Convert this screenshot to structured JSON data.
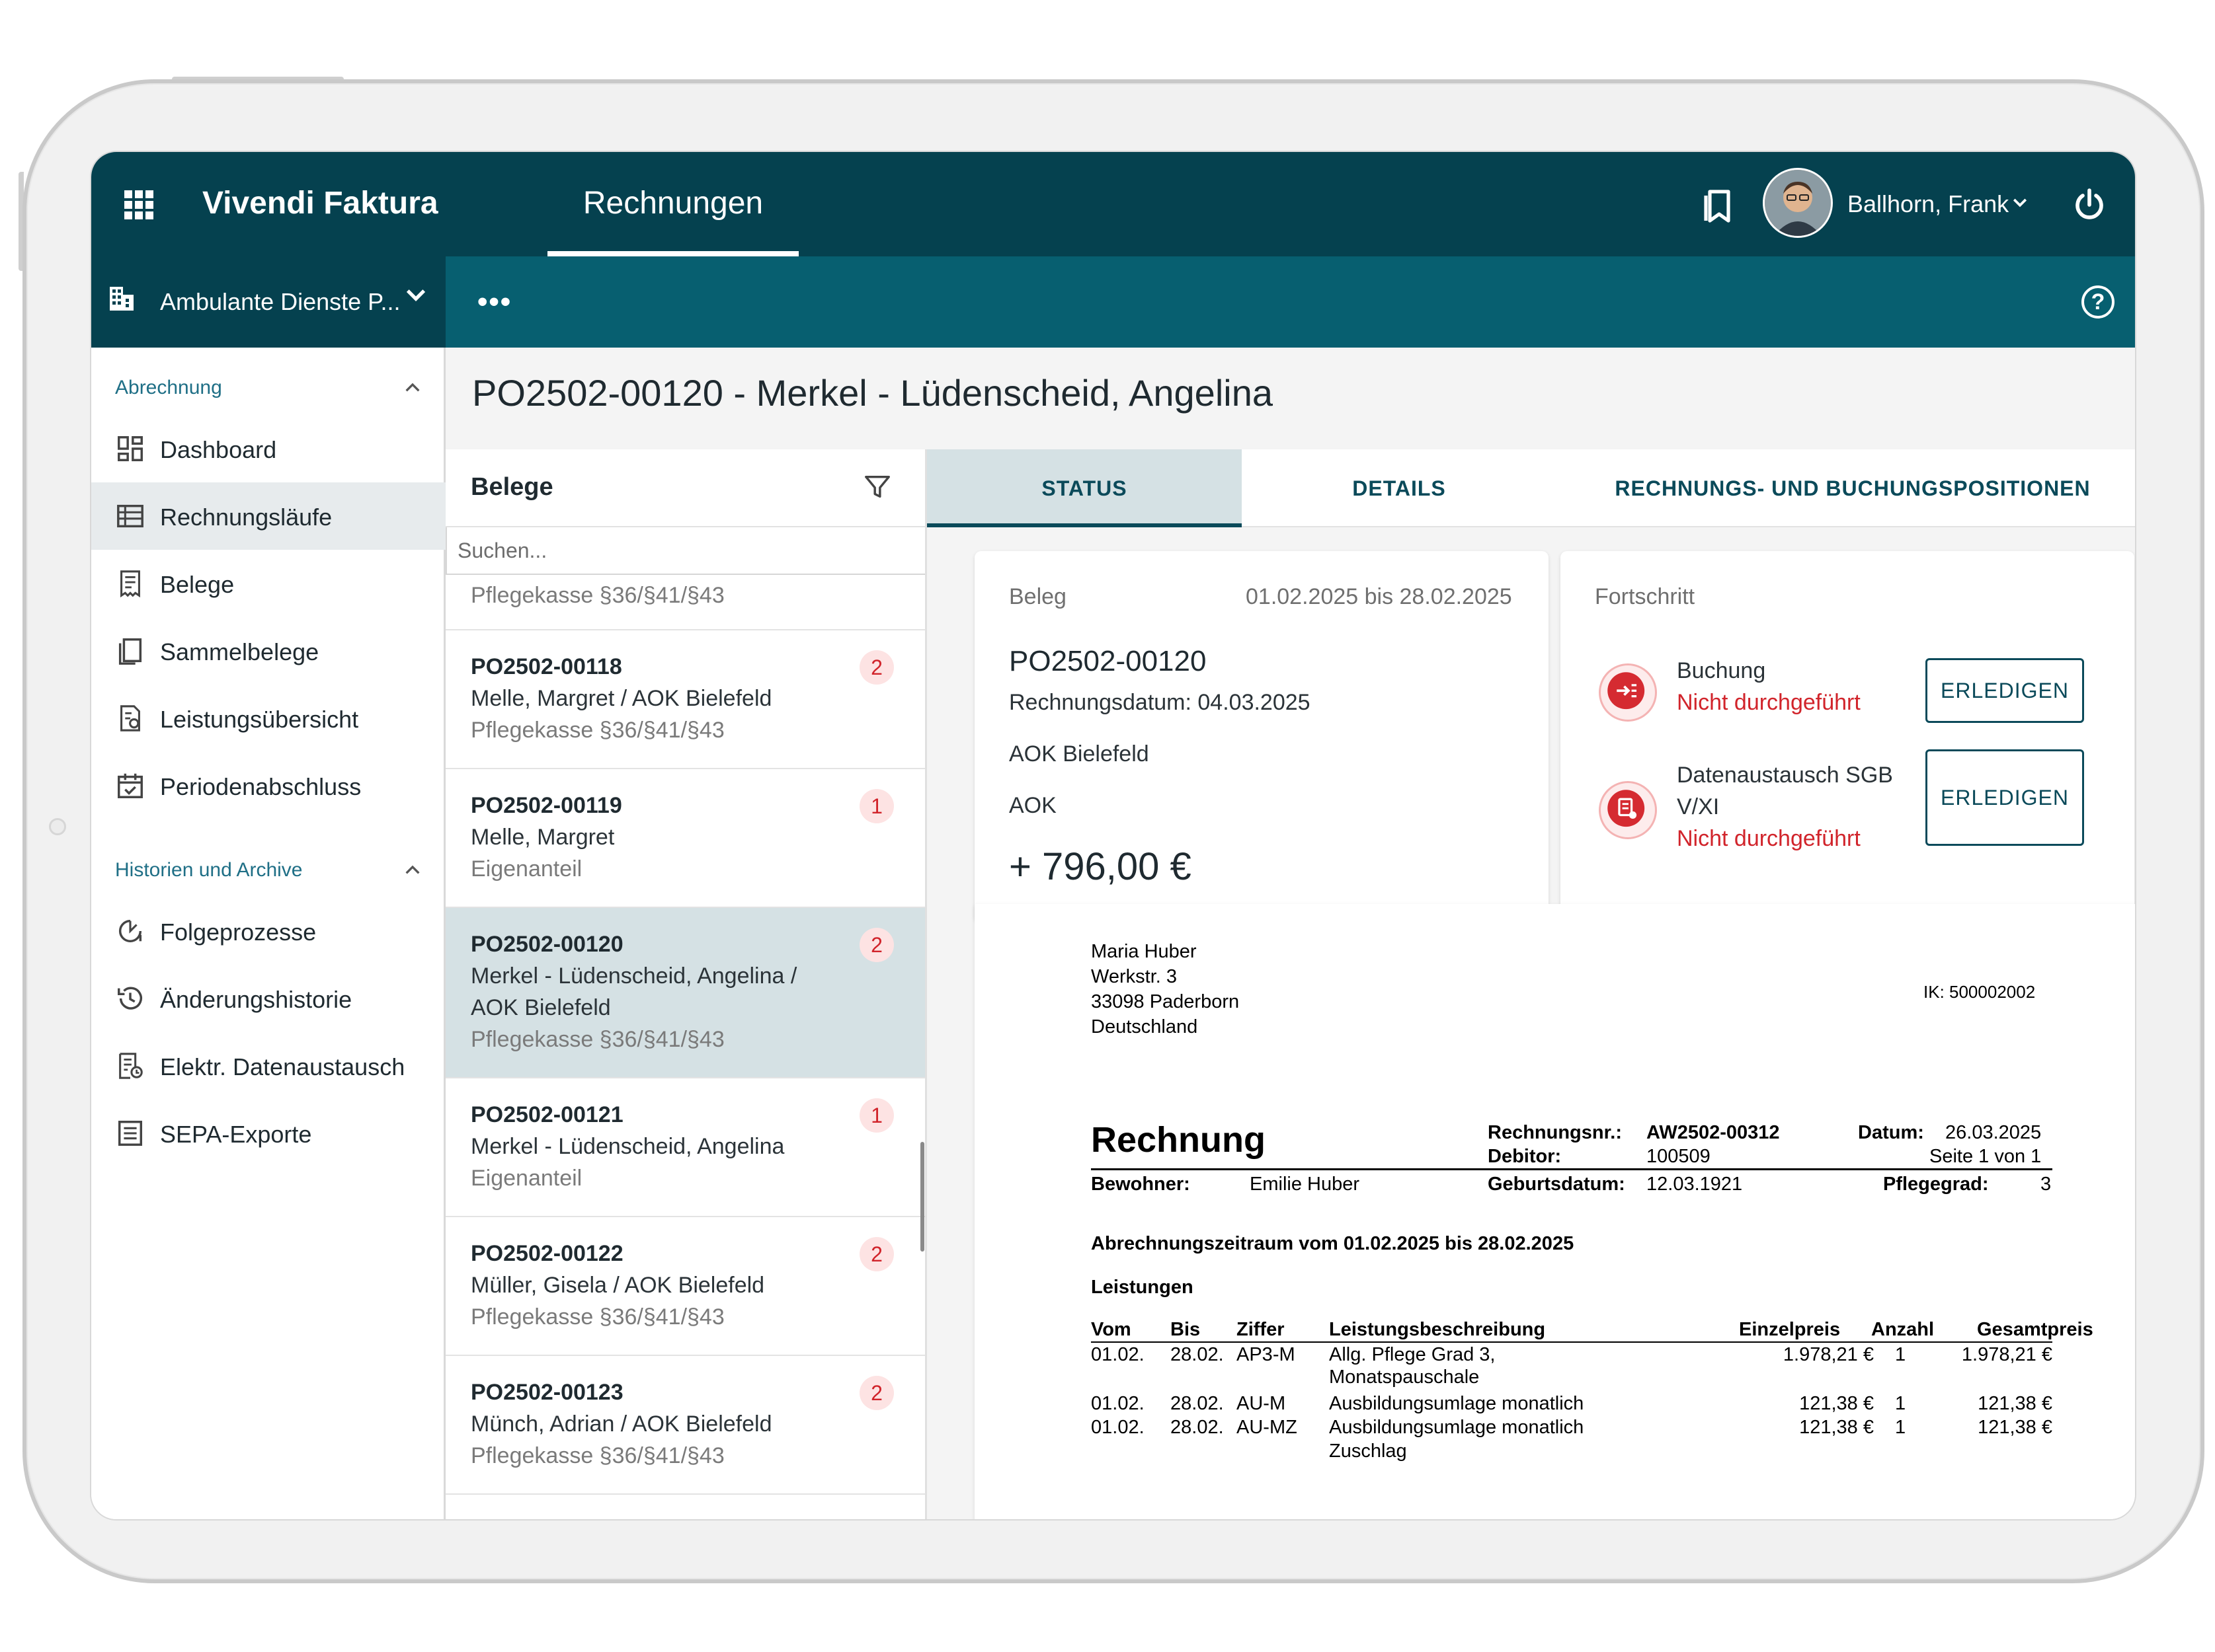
{
  "app": {
    "title": "Vivendi Faktura",
    "nav_tab": "Rechnungen",
    "user": {
      "name": "Ballhorn, Frank"
    }
  },
  "org": {
    "label": "Ambulante Dienste P..."
  },
  "sidebar": {
    "sections": [
      {
        "title": "Abrechnung",
        "items": [
          {
            "label": "Dashboard",
            "icon": "dashboard-icon"
          },
          {
            "label": "Rechnungsläufe",
            "icon": "table-icon",
            "active": true
          },
          {
            "label": "Belege",
            "icon": "receipt-icon"
          },
          {
            "label": "Sammelbelege",
            "icon": "copy-icon"
          },
          {
            "label": "Leistungsübersicht",
            "icon": "document-settings-icon"
          },
          {
            "label": "Periodenabschluss",
            "icon": "calendar-check-icon"
          }
        ]
      },
      {
        "title": "Historien und Archive",
        "items": [
          {
            "label": "Folgeprozesse",
            "icon": "process-icon"
          },
          {
            "label": "Änderungshistorie",
            "icon": "history-icon"
          },
          {
            "label": "Elektr. Datenaustausch",
            "icon": "data-exchange-icon"
          },
          {
            "label": "SEPA-Exporte",
            "icon": "list-icon"
          }
        ]
      }
    ]
  },
  "page": {
    "title": "PO2502-00120 - Merkel - Lüdenscheid, Angelina"
  },
  "belege": {
    "title": "Belege",
    "search_placeholder": "Suchen...",
    "partial_item_type": "Pflegekasse §36/§41/§43",
    "items": [
      {
        "id": "PO2502-00118",
        "name": "Melle, Margret / AOK Bielefeld",
        "type": "Pflegekasse §36/§41/§43",
        "badge": "2"
      },
      {
        "id": "PO2502-00119",
        "name": "Melle, Margret",
        "type": "Eigenanteil",
        "badge": "1"
      },
      {
        "id": "PO2502-00120",
        "name": "Merkel - Lüdenscheid, Angelina /",
        "name2": "AOK Bielefeld",
        "type": "Pflegekasse §36/§41/§43",
        "badge": "2",
        "active": true
      },
      {
        "id": "PO2502-00121",
        "name": "Merkel - Lüdenscheid, Angelina",
        "type": "Eigenanteil",
        "badge": "1"
      },
      {
        "id": "PO2502-00122",
        "name": "Müller, Gisela / AOK Bielefeld",
        "type": "Pflegekasse §36/§41/§43",
        "badge": "2"
      },
      {
        "id": "PO2502-00123",
        "name": "Münch, Adrian / AOK Bielefeld",
        "type": "Pflegekasse §36/§41/§43",
        "badge": "2"
      }
    ]
  },
  "tabs": [
    "STATUS",
    "DETAILS",
    "RECHNUNGS- UND BUCHUNGSPOSITIONEN"
  ],
  "beleg_card": {
    "label": "Beleg",
    "period": "01.02.2025 bis 28.02.2025",
    "id": "PO2502-00120",
    "date": "Rechnungsdatum: 04.03.2025",
    "kasse": "AOK Bielefeld",
    "kasse_short": "AOK",
    "amount": "+ 796,00 €"
  },
  "progress_card": {
    "title": "Fortschritt",
    "steps": [
      {
        "title": "Buchung",
        "status": "Nicht durchgeführt",
        "button": "ERLEDIGEN"
      },
      {
        "title": "Datenaustausch SGB",
        "title2": "V/XI",
        "status": "Nicht durchgeführt",
        "button": "ERLEDIGEN"
      }
    ]
  },
  "invoice": {
    "address": [
      "Maria Huber",
      "Werkstr. 3",
      "33098 Paderborn",
      "Deutschland"
    ],
    "ik": "IK: 500002002",
    "heading": "Rechnung",
    "rechnungsnr_label": "Rechnungsnr.:",
    "rechnungsnr": "AW2502-00312",
    "debitor_label": "Debitor:",
    "debitor": "100509",
    "datum_label": "Datum:",
    "datum": "26.03.2025",
    "seite": "Seite 1 von 1",
    "bewohner_label": "Bewohner:",
    "bewohner": "Emilie Huber",
    "geburtsdatum_label": "Geburtsdatum:",
    "geburtsdatum": "12.03.1921",
    "pflegegrad_label": "Pflegegrad:",
    "pflegegrad": "3",
    "zeitraum": "Abrechnungszeitraum vom 01.02.2025 bis 28.02.2025",
    "leistungen": "Leistungen",
    "columns": [
      "Vom",
      "Bis",
      "Ziffer",
      "Leistungsbeschreibung",
      "Einzelpreis",
      "Anzahl",
      "Gesamtpreis"
    ],
    "rows": [
      {
        "vom": "01.02.",
        "bis": "28.02.",
        "ziffer": "AP3-M",
        "desc": "Allg. Pflege Grad 3,",
        "desc2": "Monatspauschale",
        "einzel": "1.978,21 €",
        "anzahl": "1",
        "gesamt": "1.978,21 €"
      },
      {
        "vom": "01.02.",
        "bis": "28.02.",
        "ziffer": "AU-M",
        "desc": "Ausbildungsumlage monatlich",
        "desc2": "",
        "einzel": "121,38 €",
        "anzahl": "1",
        "gesamt": "121,38 €"
      },
      {
        "vom": "01.02.",
        "bis": "28.02.",
        "ziffer": "AU-MZ",
        "desc": "Ausbildungsumlage monatlich",
        "desc2": "Zuschlag",
        "einzel": "121,38 €",
        "anzahl": "1",
        "gesamt": "121,38 €"
      }
    ]
  },
  "colors": {
    "topbar": "#05414f",
    "subbar": "#075f70",
    "accent": "#0b4a5a",
    "error": "#d1242b",
    "active_bg": "#d5e1e4"
  }
}
